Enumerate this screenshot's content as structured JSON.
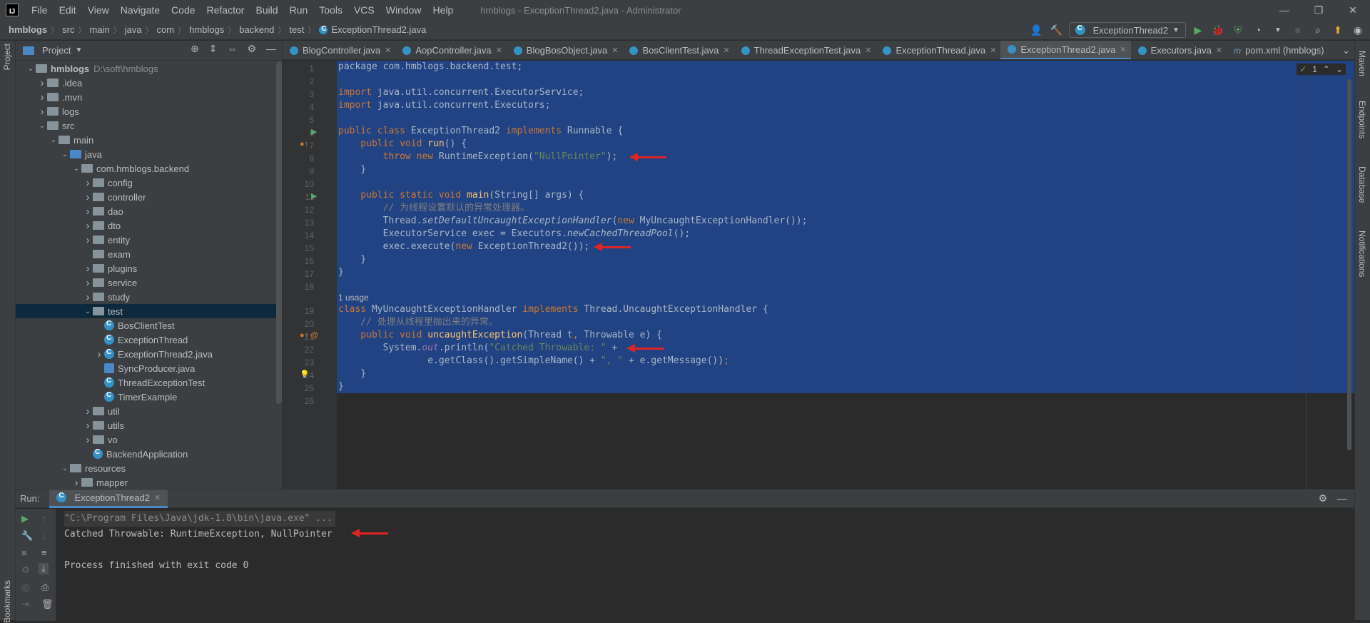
{
  "menubar": {
    "logo": "IJ",
    "items": [
      "File",
      "Edit",
      "View",
      "Navigate",
      "Code",
      "Refactor",
      "Build",
      "Run",
      "Tools",
      "VCS",
      "Window",
      "Help"
    ],
    "title": "hmblogs - ExceptionThread2.java - Administrator"
  },
  "breadcrumb": [
    "hmblogs",
    "src",
    "main",
    "java",
    "com",
    "hmblogs",
    "backend",
    "test",
    "ExceptionThread2.java"
  ],
  "toolbar": {
    "run_config": "ExceptionThread2"
  },
  "left_stripe": {
    "project_label": "Project",
    "bookmarks_label": "Bookmarks"
  },
  "right_stripe": [
    "Maven",
    "Endpoints",
    "Database",
    "Notifications"
  ],
  "project_panel": {
    "title": "Project",
    "tree": [
      {
        "label": "hmblogs",
        "extra": "D:\\soft\\hmblogs",
        "depth": 0,
        "arrow": "v",
        "icon": "folder",
        "bold": true
      },
      {
        "label": ".idea",
        "depth": 1,
        "arrow": ">",
        "icon": "folder"
      },
      {
        "label": ".mvn",
        "depth": 1,
        "arrow": ">",
        "icon": "folder"
      },
      {
        "label": "logs",
        "depth": 1,
        "arrow": ">",
        "icon": "folder"
      },
      {
        "label": "src",
        "depth": 1,
        "arrow": "v",
        "icon": "folder"
      },
      {
        "label": "main",
        "depth": 2,
        "arrow": "v",
        "icon": "folder"
      },
      {
        "label": "java",
        "depth": 3,
        "arrow": "v",
        "icon": "folder-blue"
      },
      {
        "label": "com.hmblogs.backend",
        "depth": 4,
        "arrow": "v",
        "icon": "folder"
      },
      {
        "label": "config",
        "depth": 5,
        "arrow": ">",
        "icon": "folder"
      },
      {
        "label": "controller",
        "depth": 5,
        "arrow": ">",
        "icon": "folder"
      },
      {
        "label": "dao",
        "depth": 5,
        "arrow": ">",
        "icon": "folder"
      },
      {
        "label": "dto",
        "depth": 5,
        "arrow": ">",
        "icon": "folder"
      },
      {
        "label": "entity",
        "depth": 5,
        "arrow": ">",
        "icon": "folder"
      },
      {
        "label": "exam",
        "depth": 5,
        "arrow": "",
        "icon": "folder"
      },
      {
        "label": "plugins",
        "depth": 5,
        "arrow": ">",
        "icon": "folder"
      },
      {
        "label": "service",
        "depth": 5,
        "arrow": ">",
        "icon": "folder"
      },
      {
        "label": "study",
        "depth": 5,
        "arrow": ">",
        "icon": "folder"
      },
      {
        "label": "test",
        "depth": 5,
        "arrow": "v",
        "icon": "folder",
        "selected": true
      },
      {
        "label": "BosClientTest",
        "depth": 6,
        "arrow": "",
        "icon": "class"
      },
      {
        "label": "ExceptionThread",
        "depth": 6,
        "arrow": "",
        "icon": "class"
      },
      {
        "label": "ExceptionThread2.java",
        "depth": 6,
        "arrow": ">",
        "icon": "class"
      },
      {
        "label": "SyncProducer.java",
        "depth": 6,
        "arrow": "",
        "icon": "java"
      },
      {
        "label": "ThreadExceptionTest",
        "depth": 6,
        "arrow": "",
        "icon": "class"
      },
      {
        "label": "TimerExample",
        "depth": 6,
        "arrow": "",
        "icon": "class"
      },
      {
        "label": "util",
        "depth": 5,
        "arrow": ">",
        "icon": "folder"
      },
      {
        "label": "utils",
        "depth": 5,
        "arrow": ">",
        "icon": "folder"
      },
      {
        "label": "vo",
        "depth": 5,
        "arrow": ">",
        "icon": "folder"
      },
      {
        "label": "BackendApplication",
        "depth": 5,
        "arrow": "",
        "icon": "class"
      },
      {
        "label": "resources",
        "depth": 3,
        "arrow": "v",
        "icon": "folder-res"
      },
      {
        "label": "mapper",
        "depth": 4,
        "arrow": ">",
        "icon": "folder"
      }
    ]
  },
  "tabs": [
    {
      "label": "BlogController.java",
      "active": false
    },
    {
      "label": "AopController.java",
      "active": false
    },
    {
      "label": "BlogBosObject.java",
      "active": false
    },
    {
      "label": "BosClientTest.java",
      "active": false
    },
    {
      "label": "ThreadExceptionTest.java",
      "active": false
    },
    {
      "label": "ExceptionThread.java",
      "active": false
    },
    {
      "label": "ExceptionThread2.java",
      "active": true
    },
    {
      "label": "Executors.java",
      "active": false
    },
    {
      "label": "pom.xml (hmblogs)",
      "active": false,
      "maven": true
    }
  ],
  "editor": {
    "inspection_count": "1",
    "usage_hint": "1 usage",
    "line_numbers": [
      "1",
      "2",
      "3",
      "4",
      "5",
      "6",
      "7",
      "8",
      "9",
      "10",
      "11",
      "12",
      "13",
      "14",
      "15",
      "16",
      "17",
      "18",
      "19",
      "20",
      "21",
      "22",
      "23",
      "24",
      "25",
      "26"
    ],
    "code": {
      "l1": "package com.hmblogs.backend.test;",
      "l3a": "import",
      "l3b": " java.util.concurrent.ExecutorService;",
      "l4a": "import",
      "l4b": " java.util.concurrent.Executors;",
      "l6a": "public class",
      "l6b": " ExceptionThread2 ",
      "l6c": "implements",
      "l6d": " Runnable {",
      "l7a": "    public void ",
      "l7b": "run",
      "l7c": "() {",
      "l8a": "        throw new ",
      "l8b": "RuntimeException(",
      "l8c": "\"NullPointer\"",
      "l8d": ");",
      "l9": "    }",
      "l11a": "    public static void ",
      "l11b": "main",
      "l11c": "(String[] args) {",
      "l12": "        // 为线程设置默认的异常处理器。",
      "l13a": "        Thread.",
      "l13b": "setDefaultUncaughtExceptionHandler",
      "l13c": "(",
      "l13d": "new ",
      "l13e": "MyUncaughtExceptionHandler());",
      "l14a": "        ExecutorService exec = Executors.",
      "l14b": "newCachedThreadPool",
      "l14c": "();",
      "l15a": "        exec.execute(",
      "l15b": "new ",
      "l15c": "ExceptionThread2());",
      "l16": "    }",
      "l17": "}",
      "l19a": "class",
      "l19b": " MyUncaughtExceptionHandler ",
      "l19c": "implements",
      "l19d": " Thread.UncaughtExceptionHandler {",
      "l20": "    // 处理从线程里抛出来的异常。",
      "l21a": "    public void ",
      "l21b": "uncaughtException",
      "l21c": "(Thread t",
      "l21d": ", ",
      "l21e": "Throwable e) {",
      "l22a": "        System.",
      "l22b": "out",
      "l22c": ".println(",
      "l22d": "\"Catched Throwable: \"",
      "l22e": " +",
      "l23a": "                e.getClass().getSimpleName() + ",
      "l23b": "\", \"",
      "l23c": " + e.getMessage())",
      "l23d": ";",
      "l24": "    }",
      "l25": "}"
    }
  },
  "run_panel": {
    "label": "Run:",
    "tab": "ExceptionThread2",
    "console": [
      "\"C:\\Program Files\\Java\\jdk-1.8\\bin\\java.exe\" ...",
      "Catched Throwable: RuntimeException, NullPointer",
      "",
      "Process finished with exit code 0"
    ]
  },
  "colors": {
    "accent": "#4a88c7",
    "selection": "#214283",
    "annotation_arrow": "#e02424"
  }
}
